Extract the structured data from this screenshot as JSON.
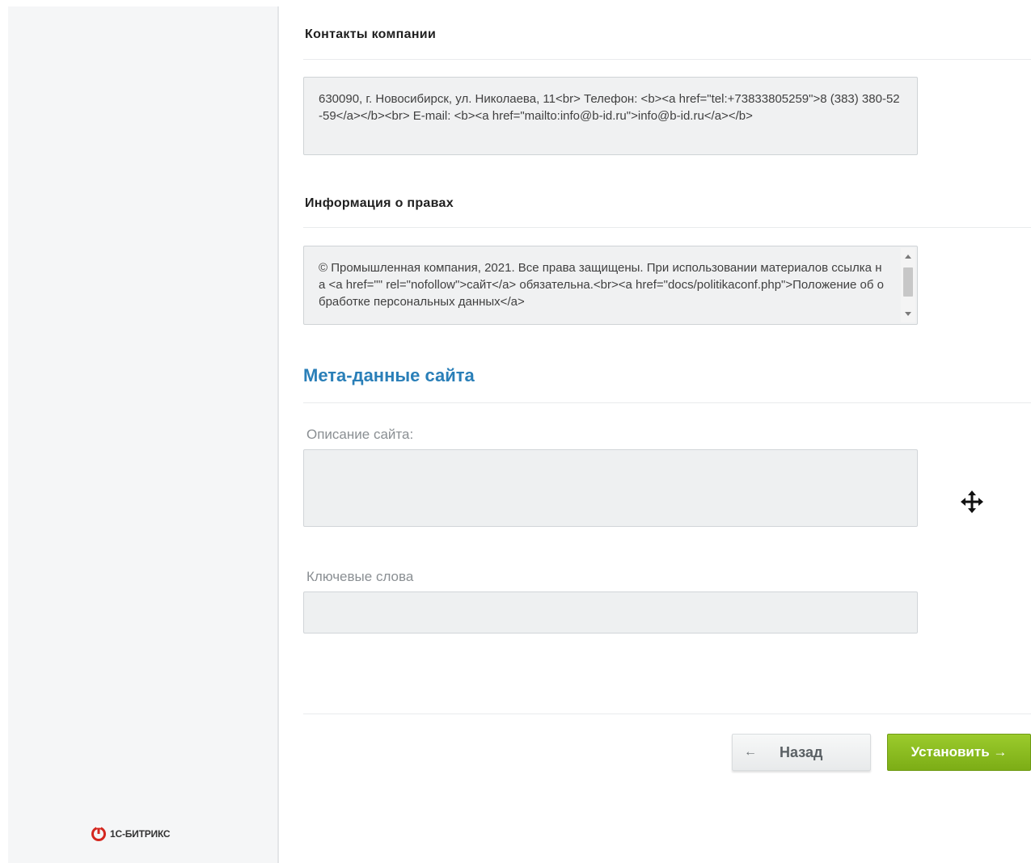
{
  "brand": {
    "name": "1С-БИТРИКС",
    "color": "#d4271f"
  },
  "contacts": {
    "title": "Контакты компании",
    "value": "630090, г. Новосибирск, ул. Николаева, 11<br> Телефон: <b><a href=\"tel:+73833805259\">8 (383) 380-52-59</a></b><br> E-mail: <b><a href=\"mailto:info@b-id.ru\">info@b-id.ru</a></b>"
  },
  "rights": {
    "title": "Информация о правах",
    "value": "© Промышленная компания, 2021. Все права защищены. При использовании материалов ссылка на <a href=\"\" rel=\"nofollow\">сайт</a> обязательна.<br><a href=\"docs/politikaconf.php\">Положение об обработке персональных данных</a>"
  },
  "meta": {
    "title": "Мета-данные сайта",
    "title_color": "#2a7fb8",
    "description": {
      "label": "Описание сайта:",
      "value": ""
    },
    "keywords": {
      "label": "Ключевые слова",
      "value": ""
    }
  },
  "buttons": {
    "back_label": "Назад",
    "back_icon": "arrow-left-icon",
    "install_label": "Установить →",
    "install_color": "#8cbf22"
  },
  "cursor": {
    "icon": "move-cursor-icon"
  }
}
